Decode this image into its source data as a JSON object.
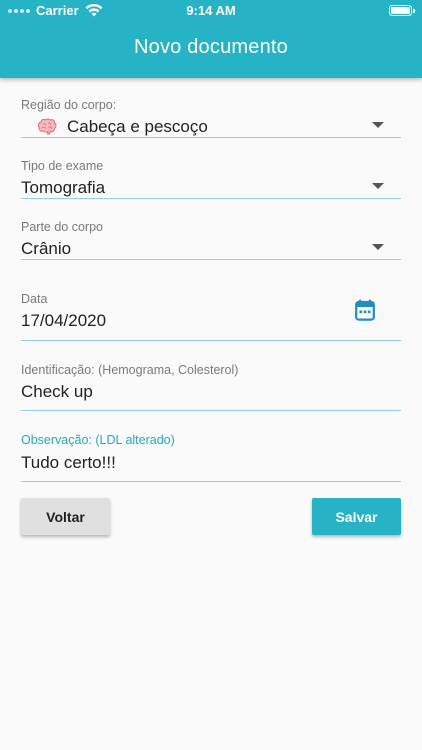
{
  "status_bar": {
    "carrier": "Carrier",
    "time": "9:14 AM"
  },
  "header": {
    "title": "Novo documento"
  },
  "form": {
    "body_region": {
      "label": "Região do corpo:",
      "value": "Cabeça e pescoço",
      "icon": "brain-icon"
    },
    "exam_type": {
      "label": "Tipo de exame",
      "value": "Tomografia"
    },
    "body_part": {
      "label": "Parte do corpo",
      "value": "Crânio"
    },
    "date": {
      "label": "Data",
      "value": "17/04/2020",
      "icon": "calendar-icon"
    },
    "identification": {
      "label": "Identificação: (Hemograma, Colesterol)",
      "value": "Check up"
    },
    "observation": {
      "label": "Observação: (LDL alterado)",
      "value": "Tudo certo!!!"
    }
  },
  "actions": {
    "back_label": "Voltar",
    "save_label": "Salvar"
  },
  "colors": {
    "primary": "#26b3c6",
    "background": "#fafafa",
    "secondary_button": "#e0e0e0"
  }
}
